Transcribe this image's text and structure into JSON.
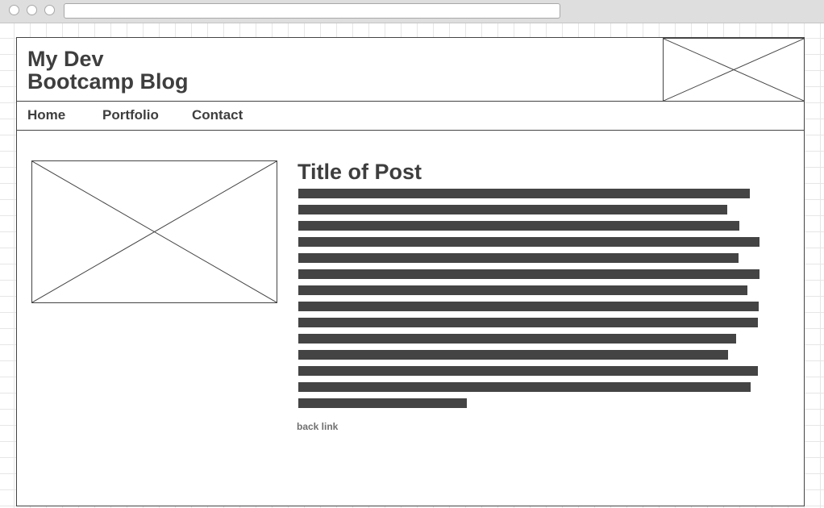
{
  "header": {
    "title_line1": "My Dev",
    "title_line2": "Bootcamp Blog"
  },
  "nav": {
    "items": [
      {
        "label": "Home"
      },
      {
        "label": "Portfolio"
      },
      {
        "label": "Contact"
      }
    ]
  },
  "post": {
    "title": "Title of Post",
    "back_link": "back link"
  },
  "colors": {
    "text": "#3e3e3e",
    "text_placeholder": "#444444",
    "grid": "#e6e6e6",
    "chrome": "#dedede"
  }
}
